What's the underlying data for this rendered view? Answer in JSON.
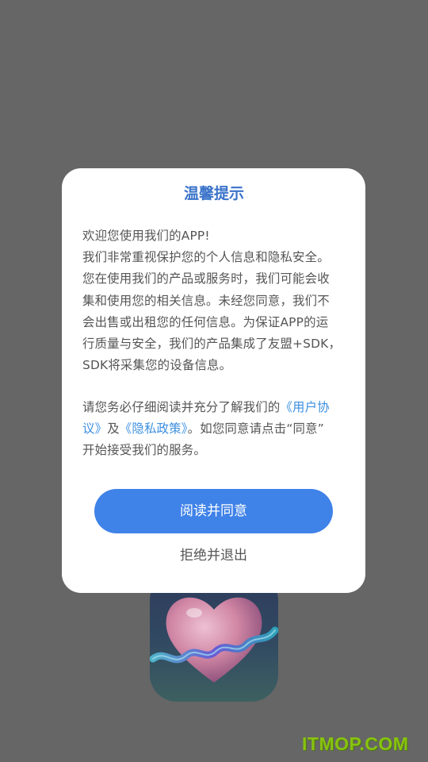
{
  "dialog": {
    "title": "温馨提示",
    "paragraph1_lines": [
      "欢迎您使用我们的APP!",
      "我们非常重视保护您的个人信息和隐私安全。",
      "您在使用我们的产品或服务时，我们可能会收",
      "集和使用您的相关信息。未经您同意，我们不",
      "会出售或出租您的任何信息。为保证APP的运",
      "行质量与安全，我们的产品集成了友盟+SDK，",
      "SDK将采集您的设备信息。"
    ],
    "paragraph2": {
      "line1_text": "请您务必仔细阅读并充分了解我们的",
      "line1_link": "《用户协",
      "line2_link": "议》",
      "line2_and": "及",
      "line2_link2": "《隐私政策》",
      "line2_text": "。如您同意请点击“同意”",
      "line3_text": "开始接受我们的服务。"
    },
    "accept_label": "阅读并同意",
    "reject_label": "拒绝并退出"
  },
  "app_icon": {
    "icon": "heart-app-icon"
  },
  "watermark": {
    "text": "ITMOP.COM"
  },
  "colors": {
    "overlay": "#666666",
    "title": "#3a73c9",
    "link": "#3b8fe0",
    "accept_button": "#3f82e8",
    "watermark": "#8fd400"
  }
}
